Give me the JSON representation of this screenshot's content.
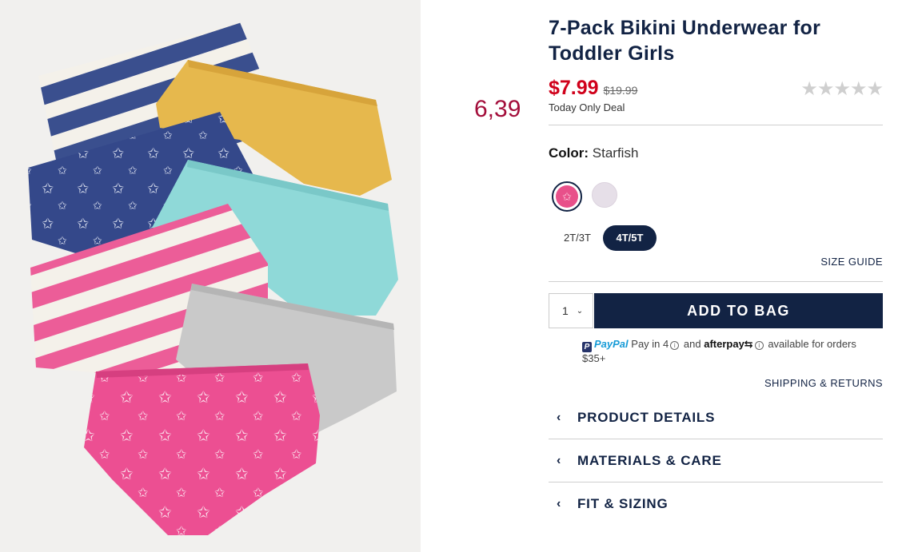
{
  "product": {
    "title": "7-Pack Bikini Underwear for Toddler Girls",
    "price_now": "$7.99",
    "price_was": "$19.99",
    "deal_text": "Today Only Deal",
    "rating_stars": "★★★★★",
    "side_price": "6,39"
  },
  "color": {
    "label": "Color:",
    "selected": "Starfish",
    "swatches": [
      {
        "name": "Starfish",
        "hex": "#e8508a"
      },
      {
        "name": "Lavender",
        "hex": "#e6dfe8"
      }
    ]
  },
  "sizes": {
    "options": [
      "2T/3T",
      "4T/5T"
    ],
    "selected": "4T/5T",
    "guide_label": "SIZE GUIDE"
  },
  "cart": {
    "quantity": "1",
    "add_label": "ADD TO BAG"
  },
  "payment": {
    "paypal_brand": "PayPal",
    "paypal_text": "Pay in 4",
    "and_text": "and",
    "afterpay_brand": "afterpay",
    "tail_text": "available for orders $35+"
  },
  "shipping_label": "SHIPPING & RETURNS",
  "accordions": [
    {
      "label": "PRODUCT DETAILS"
    },
    {
      "label": "MATERIALS & CARE"
    },
    {
      "label": "FIT & SIZING"
    }
  ],
  "colors": {
    "navy": "#122344",
    "sale_red": "#d0011b",
    "side_price": "#a30d3a"
  }
}
